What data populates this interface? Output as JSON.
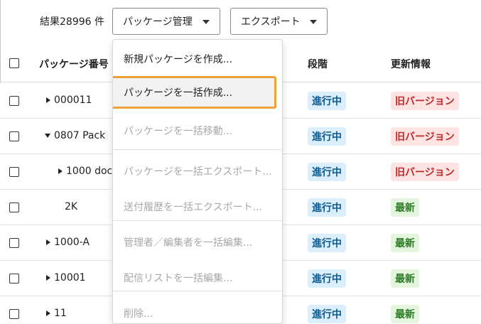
{
  "toolbar": {
    "result_count": "結果28996 件",
    "package_menu_label": "パッケージ管理",
    "export_label": "エクスポート"
  },
  "table": {
    "headers": {
      "package_number": "パッケージ番号",
      "stage": "段階",
      "update_info": "更新情報"
    },
    "rows": [
      {
        "name": "000011",
        "expander": "collapsed",
        "stage": "進行中",
        "update": "旧バージョン",
        "update_kind": "old"
      },
      {
        "name": "0807 Pack",
        "expander": "expanded",
        "stage": "進行中",
        "update": "旧バージョン",
        "update_kind": "old"
      },
      {
        "name": "1000 docu",
        "expander": "collapsed",
        "stage": "進行中",
        "update": "旧バージョン",
        "update_kind": "old"
      },
      {
        "name": "2K",
        "expander": "none",
        "stage": "進行中",
        "update": "最新",
        "update_kind": "new"
      },
      {
        "name": "1000-A",
        "expander": "collapsed",
        "stage": "進行中",
        "update": "最新",
        "update_kind": "new"
      },
      {
        "name": "10001",
        "expander": "collapsed",
        "stage": "進行中",
        "update": "最新",
        "update_kind": "new"
      },
      {
        "name": "11",
        "expander": "collapsed",
        "stage": "進行中",
        "update": "最新",
        "update_kind": "new"
      }
    ]
  },
  "package_menu": {
    "items": [
      {
        "label": "新規パッケージを作成...",
        "enabled": true
      },
      {
        "label": "パッケージを一括作成...",
        "enabled": true,
        "focused": true
      },
      {
        "label": "パッケージを一括移動...",
        "enabled": false
      },
      {
        "label": "パッケージを一括エクスポート...",
        "enabled": false
      },
      {
        "label": "送付履歴を一括エクスポート...",
        "enabled": false
      },
      {
        "label": "管理者／編集者を一括編集...",
        "enabled": false
      },
      {
        "label": "配信リストを一括編集...",
        "enabled": false
      },
      {
        "label": "削除...",
        "enabled": false
      }
    ]
  },
  "colors": {
    "focus_ring": "#f0a23a",
    "stage_badge_bg": "#dbeefc",
    "old_badge_bg": "#fde3e1",
    "new_badge_bg": "#e4f5dd"
  }
}
